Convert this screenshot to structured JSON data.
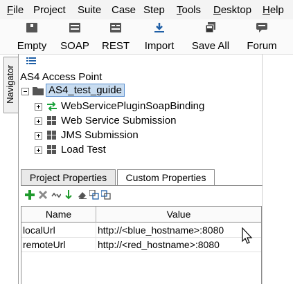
{
  "menu": {
    "items": [
      {
        "pre": "",
        "ul": "F",
        "post": "ile"
      },
      {
        "pre": "Project",
        "ul": "",
        "post": ""
      },
      {
        "pre": "Suite",
        "ul": "",
        "post": ""
      },
      {
        "pre": "Case",
        "ul": "",
        "post": ""
      },
      {
        "pre": "Step",
        "ul": "",
        "post": ""
      },
      {
        "pre": "",
        "ul": "T",
        "post": "ools"
      },
      {
        "pre": "",
        "ul": "D",
        "post": "esktop"
      },
      {
        "pre": "",
        "ul": "H",
        "post": "elp"
      }
    ]
  },
  "toolbar": {
    "buttons": [
      {
        "label": "Empty",
        "icon": "empty-project-icon"
      },
      {
        "label": "SOAP",
        "icon": "soap-project-icon"
      },
      {
        "label": "REST",
        "icon": "rest-project-icon"
      },
      {
        "label": "Import",
        "icon": "import-icon"
      },
      {
        "label": "Save All",
        "icon": "save-all-icon"
      },
      {
        "label": "Forum",
        "icon": "forum-icon"
      }
    ]
  },
  "navigator": {
    "tab_label": "Navigator",
    "root_label": "AS4 Access Point",
    "project": {
      "label": "AS4_test_guide",
      "icon": "folder-icon"
    },
    "children": [
      {
        "label": "WebServicePluginSoapBinding",
        "icon": "interface-arrows-icon"
      },
      {
        "label": "Web Service Submission",
        "icon": "test-suite-icon"
      },
      {
        "label": "JMS Submission",
        "icon": "test-suite-icon"
      },
      {
        "label": "Load Test",
        "icon": "test-suite-icon"
      }
    ]
  },
  "properties": {
    "tabs": [
      {
        "label": "Project Properties",
        "active": true
      },
      {
        "label": "Custom Properties",
        "active": false
      }
    ],
    "toolbar_icons": [
      "add-property-icon",
      "remove-property-icon",
      "move-up-down-icon",
      "move-down-icon",
      "clear-icon",
      "load-properties-icon",
      "save-properties-icon"
    ],
    "columns": [
      "Name",
      "Value"
    ],
    "rows": [
      {
        "name": "localUrl",
        "value": "http://<blue_hostname>:8080"
      },
      {
        "name": "remoteUrl",
        "value": "http://<red_hostname>:8080"
      }
    ]
  },
  "colors": {
    "add_green": "#1f9a2c",
    "selection_blue": "#c8dcf0",
    "arrow_green": "#18a23a",
    "import_blue": "#1f5fa6"
  }
}
